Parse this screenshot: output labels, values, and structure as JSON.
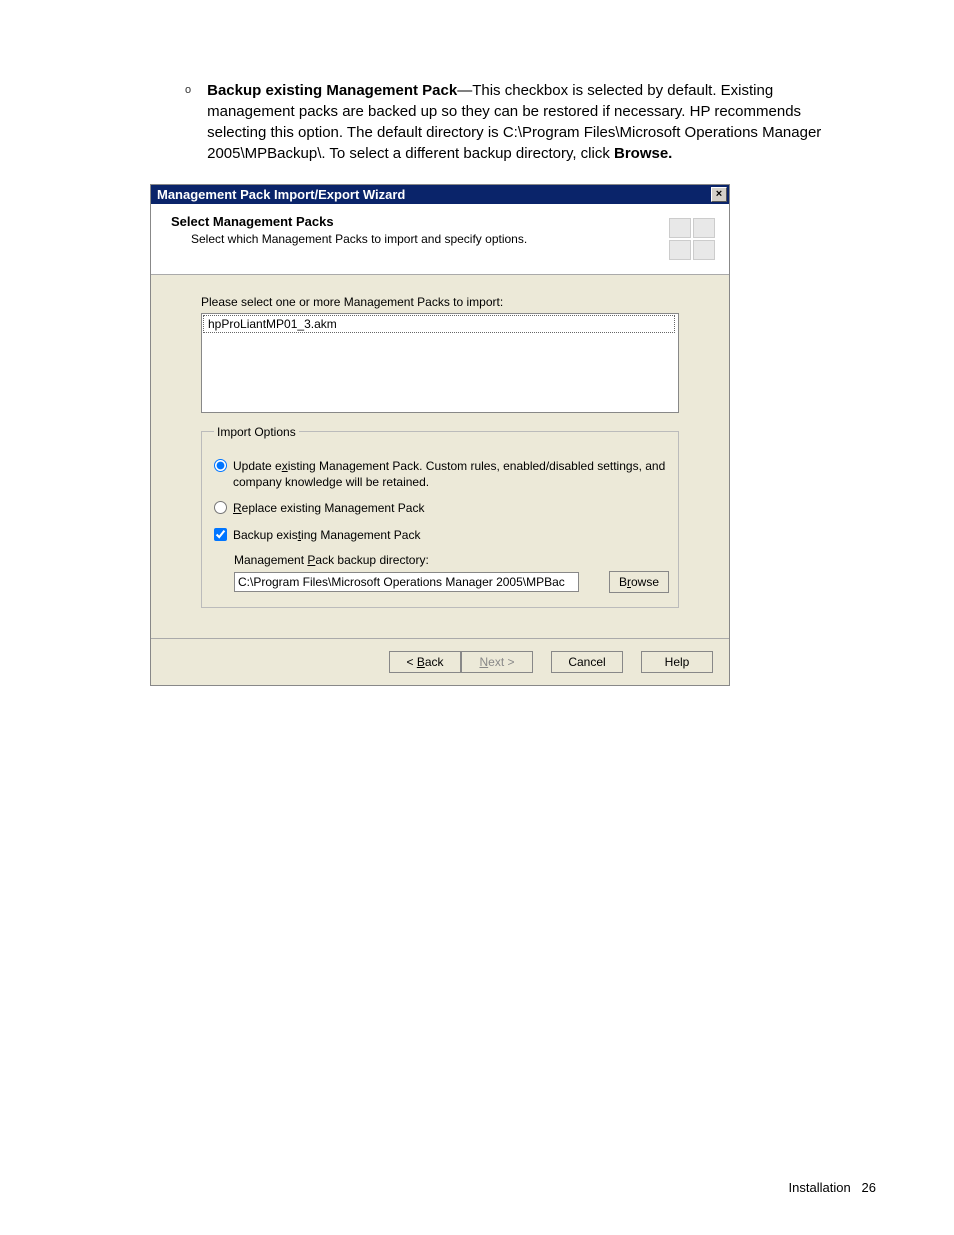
{
  "doc": {
    "bullet_marker": "o",
    "bullet_bold": "Backup existing Management Pack",
    "bullet_rest": "—This checkbox is selected by default. Existing management packs are backed up so they can be restored if necessary. HP recommends selecting this option. The default directory is C:\\Program Files\\Microsoft Operations Manager 2005\\MPBackup\\. To select a different backup directory, click ",
    "bullet_tail_bold": "Browse."
  },
  "wizard": {
    "title": "Management Pack Import/Export Wizard",
    "close": "×",
    "header_title": "Select Management Packs",
    "header_sub": "Select which Management Packs to import and specify options.",
    "prompt": "Please select one or more Management Packs to import:",
    "list_item": "hpProLiantMP01_3.akm",
    "fieldset_legend": "Import Options",
    "radio_update": "Update existing Management Pack.  Custom rules, enabled/disabled settings, and company knowledge will be retained.",
    "radio_replace": "Replace existing Management Pack",
    "check_backup": "Backup existing Management Pack",
    "backup_dir_label": "Management Pack backup directory:",
    "backup_dir_value": "C:\\Program Files\\Microsoft Operations Manager 2005\\MPBac",
    "browse": "Browse",
    "back": "< Back",
    "next": "Next >",
    "cancel": "Cancel",
    "help": "Help"
  },
  "footer": {
    "section": "Installation",
    "page": "26"
  }
}
